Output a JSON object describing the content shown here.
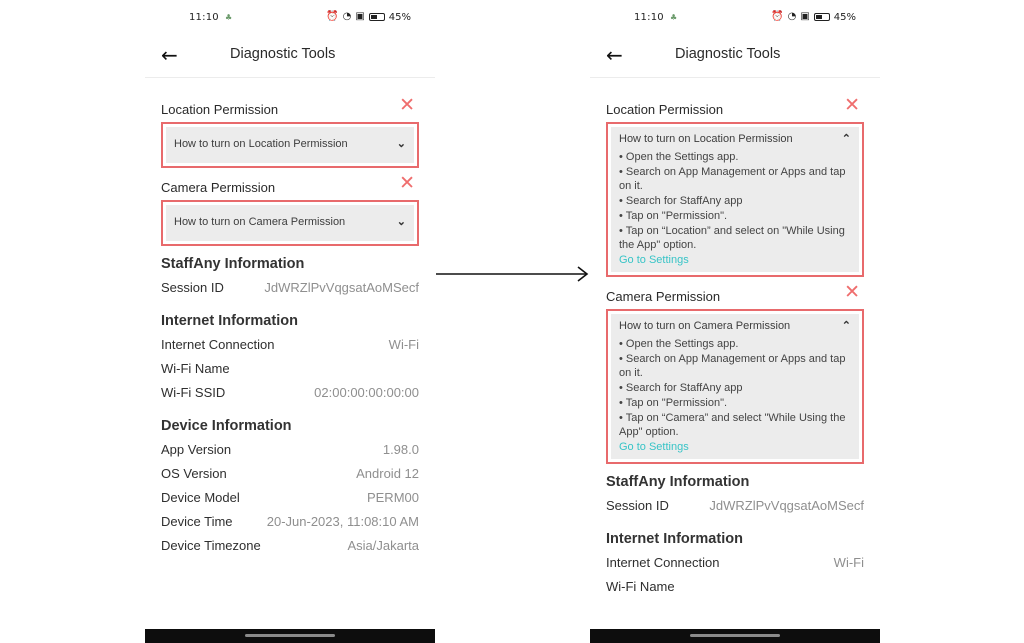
{
  "status": {
    "time": "11:10",
    "battery": "45%"
  },
  "header": {
    "title": "Diagnostic Tools"
  },
  "location": {
    "label": "Location Permission",
    "title": "How to turn on Location Permission",
    "steps": [
      "• Open the Settings app.",
      "• Search on App Management or Apps and tap on it.",
      "• Search for StaffAny app",
      "• Tap on \"Permission\".",
      "• Tap on “Location” and select on \"While Using the App\" option."
    ],
    "link": "Go to Settings"
  },
  "camera": {
    "label": "Camera Permission",
    "title": "How to turn on Camera Permission",
    "steps": [
      "• Open the Settings app.",
      "• Search on App Management or Apps and tap on it.",
      "• Search for StaffAny app",
      "• Tap on \"Permission\".",
      "• Tap on “Camera” and select \"While Using the App\" option."
    ],
    "link": "Go to Settings"
  },
  "staffany": {
    "title": "StaffAny Information",
    "session_label": "Session ID",
    "session_value": "JdWRZlPvVqgsatAoMSecf"
  },
  "internet": {
    "title": "Internet Information",
    "connection_label": "Internet Connection",
    "connection_value": "Wi-Fi",
    "wifi_name_label": "Wi-Fi Name",
    "wifi_name_value": "",
    "ssid_label": "Wi-Fi SSID",
    "ssid_value": "02:00:00:00:00:00"
  },
  "device": {
    "title": "Device Information",
    "app_version_label": "App Version",
    "app_version_value": "1.98.0",
    "os_label": "OS Version",
    "os_value": "Android 12",
    "model_label": "Device Model",
    "model_value": "PERM00",
    "time_label": "Device Time",
    "time_value": "20-Jun-2023, 11:08:10 AM",
    "tz_label": "Device Timezone",
    "tz_value": "Asia/Jakarta"
  },
  "colors": {
    "highlight_border": "#e86a6c",
    "close_icon": "#ef6d6d",
    "link": "#38c4c7"
  },
  "icons": {
    "back": "back-arrow-icon",
    "close": "close-icon",
    "expand": "chevron-down-icon",
    "collapse": "chevron-up-icon",
    "transition": "right-arrow-icon"
  }
}
